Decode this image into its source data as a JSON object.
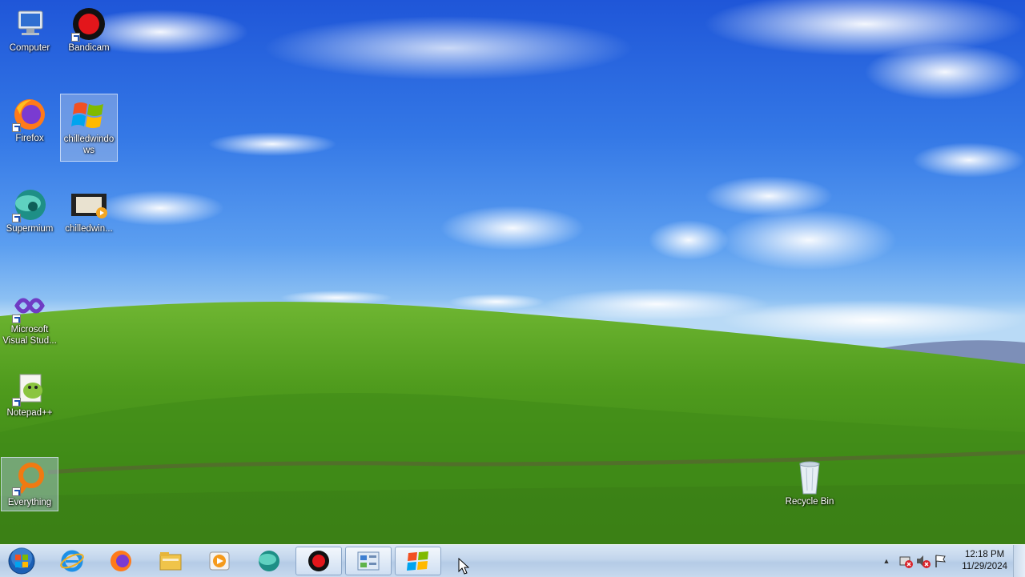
{
  "desktop": {
    "icons": [
      {
        "label": "Computer",
        "icon": "computer-icon"
      },
      {
        "label": "Bandicam",
        "icon": "bandicam-icon"
      },
      {
        "label": "Firefox",
        "icon": "firefox-icon"
      },
      {
        "label": "chilledwindo\nws",
        "icon": "windows-logo-icon"
      },
      {
        "label": "Supermium",
        "icon": "supermium-icon"
      },
      {
        "label": "chilledwin...",
        "icon": "video-file-icon"
      },
      {
        "label": "Microsoft\nVisual Stud...",
        "icon": "visual-studio-icon"
      },
      {
        "label": "Notepad++",
        "icon": "notepadpp-icon"
      },
      {
        "label": "Everything",
        "icon": "everything-search-icon"
      },
      {
        "label": "Recycle Bin",
        "icon": "recycle-bin-icon"
      }
    ]
  },
  "taskbar": {
    "start": "start-orb-icon",
    "pinned": [
      "internet-explorer-icon",
      "firefox-icon",
      "file-explorer-icon",
      "media-player-icon",
      "supermium-icon",
      "bandicam-icon",
      "control-panel-icon",
      "windows-logo-icon"
    ],
    "tray": {
      "time": "12:18 PM",
      "date": "11/29/2024"
    }
  }
}
